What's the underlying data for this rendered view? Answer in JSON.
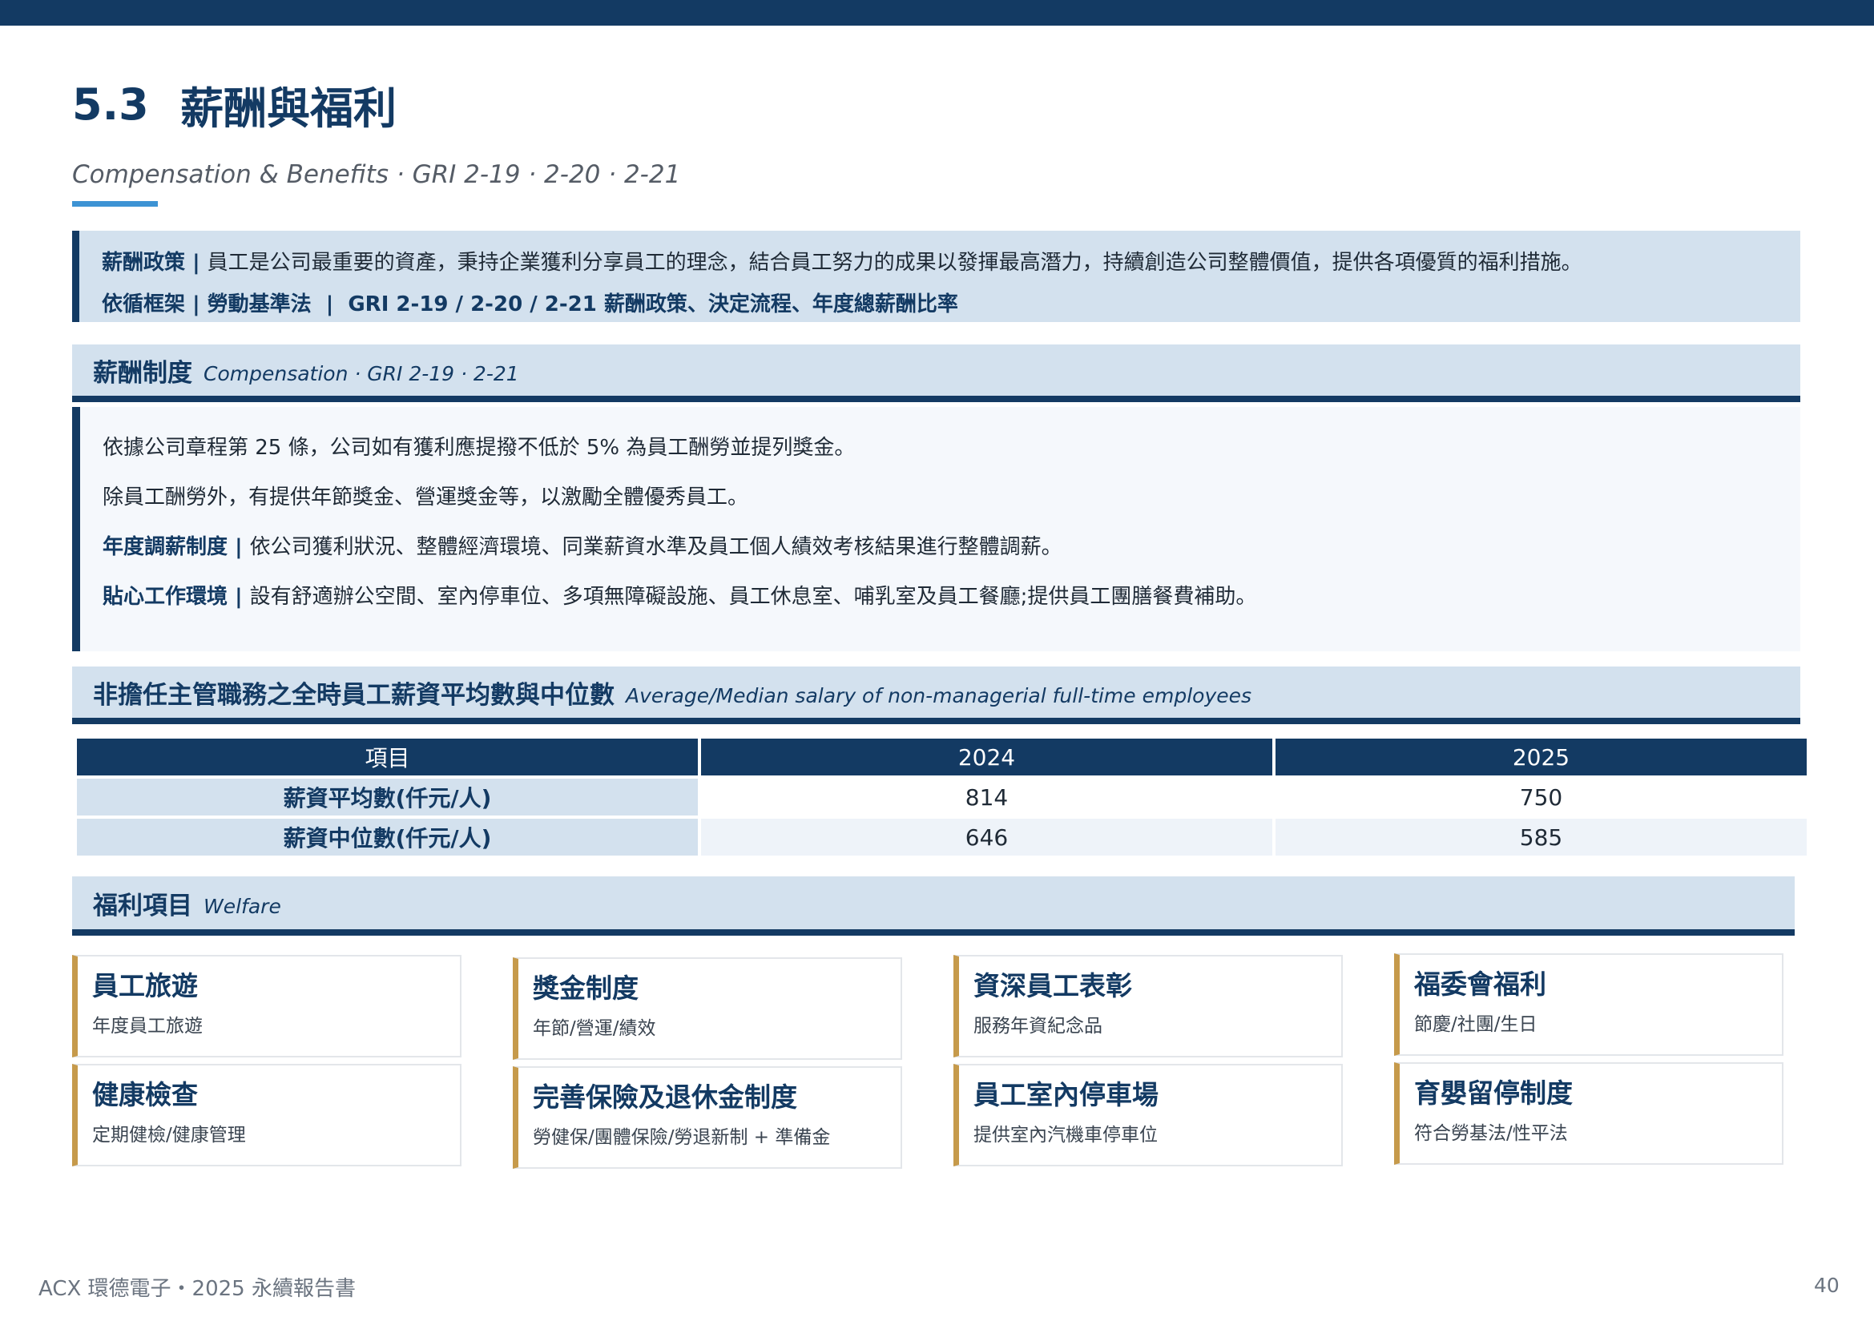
{
  "header": {
    "section_number": "5.3",
    "title": "薪酬與福利",
    "subtitle": "Compensation & Benefits · GRI 2-19 · 2-20 · 2-21"
  },
  "policy": {
    "line1_label": "薪酬政策",
    "line1_sep": " | ",
    "line1_text": "員工是公司最重要的資產，秉持企業獲利分享員工的理念，結合員工努力的成果以發揮最高潛力，持續創造公司整體價值，提供各項優質的福利措施。",
    "line2_label": "依循框架",
    "line2_sep": " | ",
    "line2_text": "勞動基準法",
    "line2_sep2": "  |  ",
    "line2_gri": "GRI 2-19 / 2-20 / 2-21 薪酬政策、決定流程、年度總薪酬比率"
  },
  "compensation": {
    "heading_zh": "薪酬制度",
    "heading_en": "Compensation · GRI 2-19 · 2-21",
    "line1": "依據公司章程第 25 條，公司如有獲利應提撥不低於 5% 為員工酬勞並提列獎金。",
    "line2": "除員工酬勞外，有提供年節獎金、營運獎金等，以激勵全體優秀員工。",
    "line3_label": "年度調薪制度",
    "line3_sep": " | ",
    "line3_text": "依公司獲利狀況、整體經濟環境、同業薪資水準及員工個人績效考核結果進行整體調薪。",
    "line4_label": "貼心工作環境",
    "line4_sep": " | ",
    "line4_text": "設有舒適辦公空間、室內停車位、多項無障礙設施、員工休息室、哺乳室及員工餐廳;提供員工團膳餐費補助。"
  },
  "salary": {
    "heading_zh": "非擔任主管職務之全時員工薪資平均數與中位數",
    "heading_en": "Average/Median salary of non-managerial full-time employees",
    "columns": [
      "項目",
      "2024",
      "2025"
    ],
    "rows": [
      [
        "薪資平均數(仟元/人)",
        "814",
        "750"
      ],
      [
        "薪資中位數(仟元/人)",
        "646",
        "585"
      ]
    ]
  },
  "welfare": {
    "heading_zh": "福利項目",
    "heading_en": "Welfare",
    "cards": [
      {
        "title": "員工旅遊",
        "sub": "年度員工旅遊"
      },
      {
        "title": "獎金制度",
        "sub": "年節/營運/績效"
      },
      {
        "title": "資深員工表彰",
        "sub": "服務年資紀念品"
      },
      {
        "title": "福委會福利",
        "sub": "節慶/社團/生日"
      },
      {
        "title": "健康檢查",
        "sub": "定期健檢/健康管理"
      },
      {
        "title": "完善保險及退休金制度",
        "sub": "勞健保/團體保險/勞退新制 + 準備金"
      },
      {
        "title": "員工室內停車場",
        "sub": "提供室內汽機車停車位"
      },
      {
        "title": "育嬰留停制度",
        "sub": "符合勞基法/性平法"
      }
    ]
  },
  "footer": {
    "left": "ACX 環德電子・2025 永續報告書",
    "page": "40"
  },
  "colors": {
    "navy": "#133a63",
    "light_blue": "#d3e1ee",
    "accent_blue": "#3d93d4",
    "gold": "#c69a4b"
  }
}
